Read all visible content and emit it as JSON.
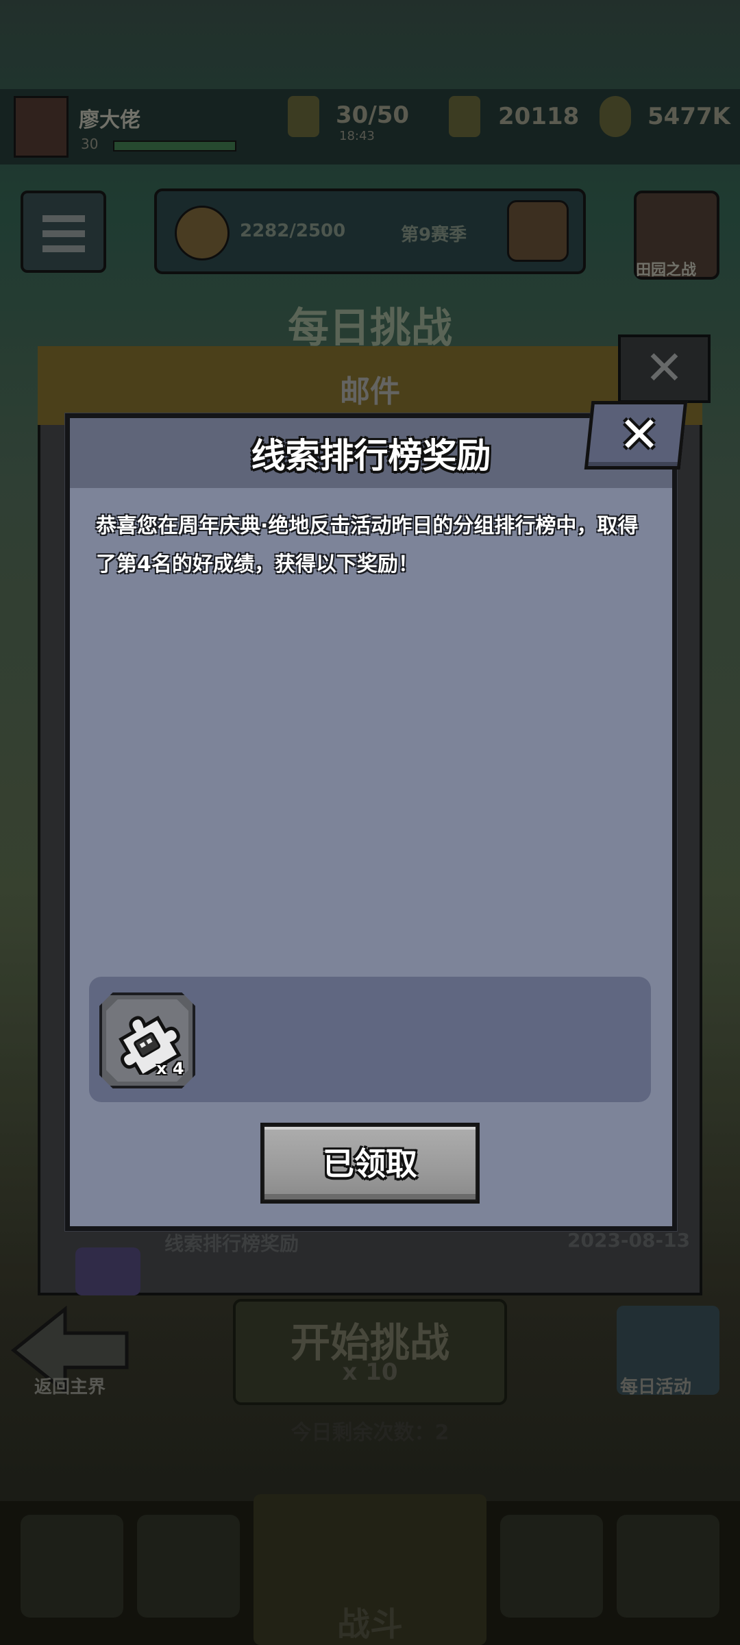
{
  "background": {
    "player_name": "廖大佬",
    "player_level": "30",
    "energy": "30/50",
    "energy_timer": "18:43",
    "coins": "20118",
    "gems": "5477K",
    "rank_progress": "2282/2500",
    "rank_label": "第9赛季",
    "side_button_label": "田园之战",
    "daily_challenge_title": "每日挑战",
    "mail_title": "邮件",
    "mail_item_title": "线索排行榜奖励",
    "mail_item_date": "2023-08-13",
    "back_label": "返回主界",
    "start_label": "开始挑战",
    "start_cost": "x 10",
    "daily_event_label": "每日活动",
    "remaining_today": "今日剩余次数：2",
    "nav_center_label": "战斗"
  },
  "dialog": {
    "title": "线索排行榜奖励",
    "message": "恭喜您在周年庆典·绝地反击活动昨日的分组排行榜中，取得了第4名的好成绩，获得以下奖励！",
    "close_icon": "close-icon",
    "reward_items": [
      {
        "icon": "puzzle-piece-icon",
        "quantity": "x 4"
      }
    ],
    "claim_button_label": "已领取"
  }
}
